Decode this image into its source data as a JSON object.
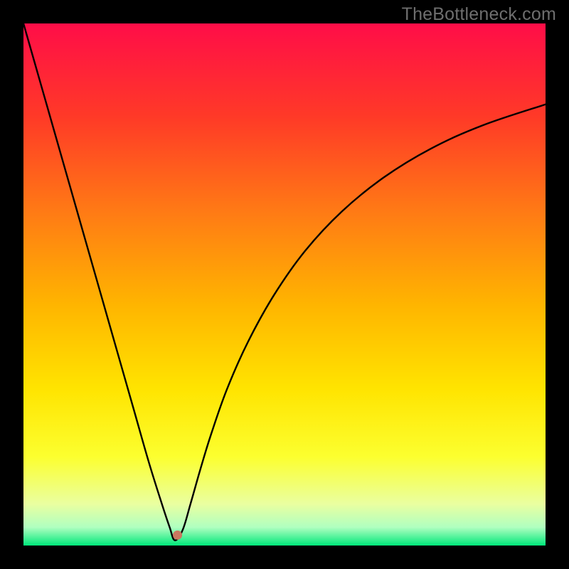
{
  "watermark": "TheBottleneck.com",
  "chart_data": {
    "type": "line",
    "title": "",
    "xlabel": "",
    "ylabel": "",
    "xlim": [
      0,
      100
    ],
    "ylim": [
      0,
      100
    ],
    "grid": false,
    "legend": false,
    "annotations": [
      {
        "x_pct": 29.5,
        "y_pct_from_bottom": 2.0,
        "label": "marker-dot"
      }
    ],
    "background_gradient": {
      "type": "vertical-rainbow",
      "stops": [
        {
          "pos": 0.0,
          "color": "#ff0d48"
        },
        {
          "pos": 0.18,
          "color": "#ff3a27"
        },
        {
          "pos": 0.36,
          "color": "#ff7a15"
        },
        {
          "pos": 0.54,
          "color": "#ffb500"
        },
        {
          "pos": 0.7,
          "color": "#ffe400"
        },
        {
          "pos": 0.83,
          "color": "#fcff2f"
        },
        {
          "pos": 0.92,
          "color": "#eaffa0"
        },
        {
          "pos": 0.965,
          "color": "#b0ffc0"
        },
        {
          "pos": 1.0,
          "color": "#00e87a"
        }
      ]
    },
    "series": [
      {
        "name": "bottleneck-curve",
        "x": [
          0,
          3,
          6,
          9,
          12,
          15,
          18,
          21,
          24,
          26.5,
          28,
          29,
          30.5,
          32,
          34,
          36,
          39,
          43,
          48,
          54,
          61,
          69,
          78,
          88,
          100
        ],
        "y": [
          100,
          89.5,
          79,
          68.5,
          58,
          47.5,
          37,
          26.5,
          16,
          8,
          3.5,
          1,
          3,
          8,
          15,
          21.5,
          30,
          39,
          48,
          56.5,
          64,
          70.5,
          76,
          80.5,
          84.5
        ],
        "note": "y is percent from bottom of plot area; x is percent from left of plot area"
      }
    ]
  }
}
